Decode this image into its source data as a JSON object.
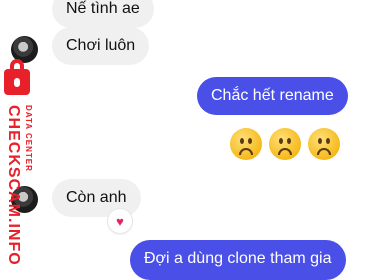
{
  "messages": [
    {
      "direction": "incoming",
      "text": "Nế tình ae"
    },
    {
      "direction": "incoming",
      "text": "Chơi luôn"
    },
    {
      "direction": "outgoing",
      "text": "Chắc hết rename"
    },
    {
      "direction": "outgoing",
      "emoji": [
        "slightly-frowning-face",
        "slightly-frowning-face",
        "slightly-frowning-face"
      ]
    },
    {
      "direction": "incoming",
      "text": "Còn anh",
      "reaction": "♥"
    },
    {
      "direction": "outgoing",
      "text": "Đợi a dùng clone tham gia"
    }
  ],
  "watermark": {
    "main": "CHECKSCAM.INFO",
    "sub": "DATA CENTER"
  },
  "colors": {
    "outgoing_bubble": "#4a4fe8",
    "incoming_bubble": "#f0f0f0",
    "watermark": "#e8202a"
  }
}
